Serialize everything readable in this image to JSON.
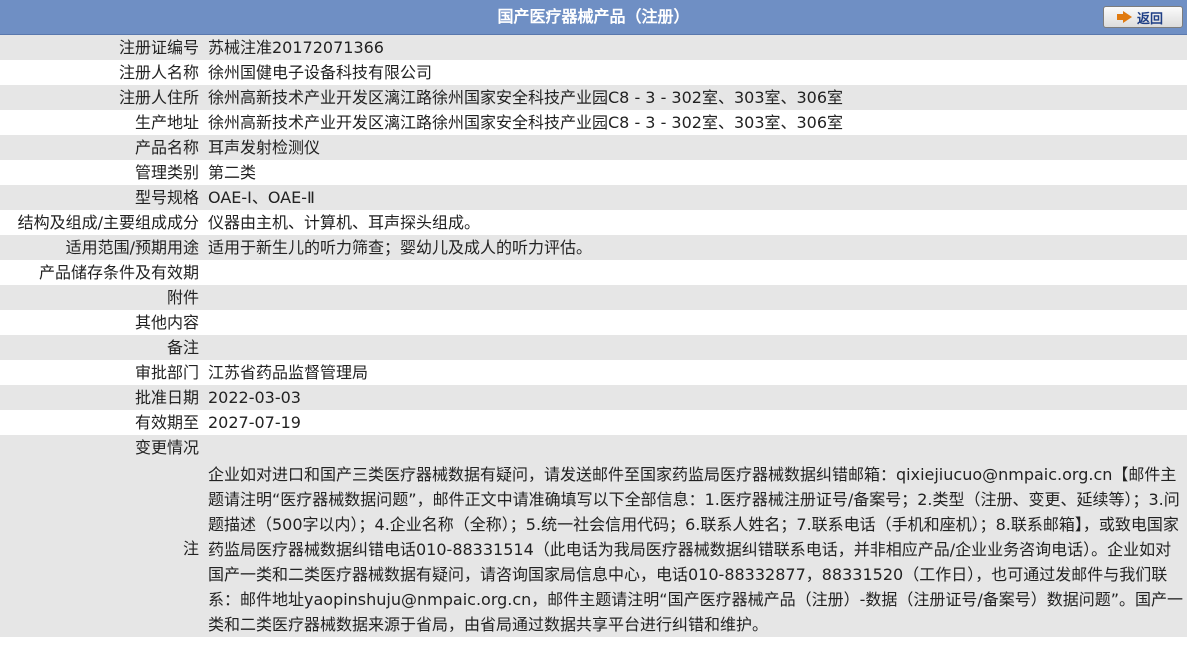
{
  "header": {
    "title": "国产医疗器械产品（注册）",
    "back_label": "返回"
  },
  "rows": [
    {
      "label": "注册证编号",
      "value": "苏械注准20172071366"
    },
    {
      "label": "注册人名称",
      "value": "徐州国健电子设备科技有限公司"
    },
    {
      "label": "注册人住所",
      "value": "徐州高新技术产业开发区漓江路徐州国家安全科技产业园C8 - 3 - 302室、303室、306室"
    },
    {
      "label": "生产地址",
      "value": "徐州高新技术产业开发区漓江路徐州国家安全科技产业园C8 - 3 - 302室、303室、306室"
    },
    {
      "label": "产品名称",
      "value": "耳声发射检测仪"
    },
    {
      "label": "管理类别",
      "value": "第二类"
    },
    {
      "label": "型号规格",
      "value": "OAE-Ⅰ、OAE-Ⅱ"
    },
    {
      "label": "结构及组成/主要组成成分",
      "value": "仪器由主机、计算机、耳声探头组成。"
    },
    {
      "label": "适用范围/预期用途",
      "value": "适用于新生儿的听力筛查；婴幼儿及成人的听力评估。"
    },
    {
      "label": "产品储存条件及有效期",
      "value": ""
    },
    {
      "label": "附件",
      "value": ""
    },
    {
      "label": "其他内容",
      "value": ""
    },
    {
      "label": "备注",
      "value": ""
    },
    {
      "label": "审批部门",
      "value": "江苏省药品监督管理局"
    },
    {
      "label": "批准日期",
      "value": "2022-03-03"
    },
    {
      "label": "有效期至",
      "value": "2027-07-19"
    },
    {
      "label": "变更情况",
      "value": ""
    }
  ],
  "note": {
    "label": "注",
    "text": "企业如对进口和国产三类医疗器械数据有疑问，请发送邮件至国家药监局医疗器械数据纠错邮箱：qixiejiucuo@nmpaic.org.cn【邮件主题请注明“医疗器械数据问题”，邮件正文中请准确填写以下全部信息：1.医疗器械注册证号/备案号；2.类型（注册、变更、延续等）；3.问题描述（500字以内）；4.企业名称（全称）；5.统一社会信用代码；6.联系人姓名；7.联系电话（手机和座机）；8.联系邮箱】，或致电国家药监局医疗器械数据纠错电话010-88331514（此电话为我局医疗器械数据纠错联系电话，并非相应产品/企业业务咨询电话）。企业如对国产一类和二类医疗器械数据有疑问，请咨询国家局信息中心，电话010-88332877，88331520（工作日），也可通过发邮件与我们联系：邮件地址yaopinshuju@nmpaic.org.cn，邮件主题请注明“国产医疗器械产品（注册）-数据（注册证号/备案号）数据问题”。国产一类和二类医疗器械数据来源于省局，由省局通过数据共享平台进行纠错和维护。"
  }
}
